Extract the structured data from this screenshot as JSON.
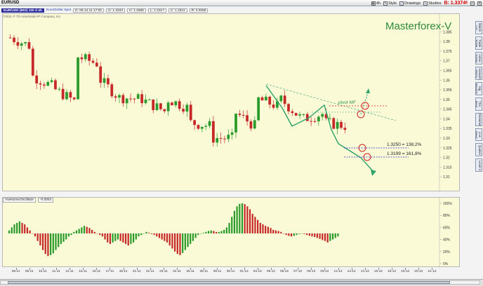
{
  "window": {
    "symbol": "EURUSD",
    "bid_price": "B: 1.3374",
    "bid_suffix": "6",
    "toolbar": [
      {
        "label": "4h",
        "icon": "timeframe-icon"
      },
      {
        "label": "Style",
        "icon": "style-icon"
      },
      {
        "label": "Drawings",
        "icon": "drawings-icon"
      },
      {
        "label": "Studies",
        "icon": "studies-icon"
      }
    ]
  },
  "infobar": {
    "sym": "EUR/USD (BID) 100 d 4h",
    "symname": "Euro/Dollar Spot",
    "date": "D: 09.12.11 17:00",
    "open": "O: 1.3333",
    "high": "H: 1.3386",
    "low": "L: 1.3317",
    "close": "C: 1.3341",
    "range": "R: 0.0069"
  },
  "copyright": "©2011 ® TD Ameritrade IP Company, Inc.",
  "annotations": {
    "brand": "Masterforex-V",
    "pivot": "pivot MF",
    "level1": "1.3250 = 138,2%",
    "level2": "1.3199 = 161,8%"
  },
  "oscillator": {
    "name": "AwesomeOscillator",
    "value": "-0.0054"
  },
  "sidepanel": [
    "Watch List",
    "Trade Ticket",
    "Active Trader",
    "Account Status",
    "Dig Reports",
    "TDA Real Time",
    "Screener",
    "Live News",
    "Quotes",
    "Level II"
  ],
  "colors": {
    "up": "#2a9a2a",
    "down": "#c62828",
    "price_bg": "#fafad7",
    "wave": "#2fa36a",
    "circle": "#d32020",
    "level_line": "#2a2acc"
  },
  "chart_data": [
    {
      "type": "candlestick",
      "title": "EURUSD 4h",
      "ylim": [
        1.305,
        1.392
      ],
      "yticks": [
        "1.385",
        "1.38",
        "1.375",
        "1.37",
        "1.365",
        "1.36",
        "1.355",
        "1.35",
        "1.345",
        "1.34",
        "1.335",
        "1.33",
        "1.325",
        "1.32",
        "1.315",
        "1.31"
      ],
      "xticks": [
        "08.11",
        "09.11",
        "10.11",
        "11.11",
        "14.11",
        "15.11",
        "16.11",
        "17.11",
        "18.11",
        "21.11",
        "22.11",
        "23.11",
        "24.11",
        "25.11",
        "28.11",
        "29.11",
        "30.11",
        "01.12",
        "02.12",
        "05.12",
        "06.12",
        "07.12",
        "08.12",
        "09.12",
        "12.12",
        "13.12",
        "14.12",
        "15.12",
        "16.12",
        "19.12",
        "20.12",
        "21.12"
      ],
      "segments": [
        [
          1.382,
          1.385,
          1.37,
          1.377
        ],
        [
          1.362,
          1.371,
          1.345,
          1.356
        ],
        [
          1.355,
          1.36,
          1.347,
          1.348
        ],
        [
          1.372,
          1.381,
          1.364,
          1.368
        ],
        [
          1.36,
          1.363,
          1.348,
          1.349
        ],
        [
          1.351,
          1.357,
          1.342,
          1.35
        ],
        [
          1.349,
          1.352,
          1.34,
          1.343
        ],
        [
          1.35,
          1.357,
          1.345,
          1.345
        ],
        [
          1.338,
          1.346,
          1.333,
          1.336
        ],
        [
          1.33,
          1.337,
          1.32,
          1.33
        ],
        [
          1.343,
          1.346,
          1.328,
          1.335
        ],
        [
          1.35,
          1.354,
          1.34,
          1.346
        ],
        [
          1.35,
          1.353,
          1.335,
          1.339
        ],
        [
          1.34,
          1.35,
          1.332,
          1.343
        ],
        [
          1.338,
          1.344,
          1.332,
          1.336
        ]
      ],
      "candles_per_segment": 6
    },
    {
      "type": "bar",
      "title": "AwesomeOscillator",
      "yticks": [
        "100%",
        "80%",
        "60%",
        "40%",
        "20%",
        "0%"
      ],
      "values": [
        0.1,
        0.2,
        0.3,
        0.35,
        0.4,
        0.35,
        0.3,
        0.2,
        0.1,
        0.0,
        -0.1,
        -0.25,
        -0.4,
        -0.55,
        -0.68,
        -0.75,
        -0.72,
        -0.66,
        -0.55,
        -0.45,
        -0.35,
        -0.28,
        -0.2,
        -0.1,
        -0.05,
        0.05,
        0.1,
        0.15,
        0.2,
        0.25,
        0.22,
        0.18,
        0.12,
        0.05,
        0.0,
        -0.05,
        -0.1,
        -0.2,
        -0.3,
        -0.35,
        -0.3,
        -0.25,
        -0.2,
        -0.25,
        -0.3,
        -0.35,
        -0.4,
        -0.35,
        -0.3,
        -0.2,
        -0.1,
        -0.05,
        0.0,
        0.05,
        0.02,
        -0.02,
        -0.05,
        -0.1,
        -0.15,
        -0.2,
        -0.25,
        -0.3,
        -0.4,
        -0.5,
        -0.6,
        -0.68,
        -0.72,
        -0.65,
        -0.55,
        -0.45,
        -0.35,
        -0.25,
        -0.15,
        -0.05,
        0.0,
        0.02,
        0.05,
        0.08,
        0.1,
        0.08,
        0.05,
        0.05,
        0.08,
        0.12,
        0.2,
        0.35,
        0.55,
        0.75,
        0.9,
        0.98,
        1.0,
        0.97,
        0.9,
        0.8,
        0.65,
        0.55,
        0.45,
        0.35,
        0.3,
        0.25,
        0.22,
        0.18,
        0.12,
        0.1,
        0.08,
        0.05,
        0.0,
        -0.05,
        -0.08,
        -0.1,
        -0.08,
        -0.05,
        -0.02,
        0.0,
        -0.02,
        -0.05,
        -0.08,
        -0.1,
        -0.12,
        -0.15,
        -0.18,
        -0.22,
        -0.25,
        -0.3,
        -0.25,
        -0.2,
        -0.15,
        -0.1
      ]
    }
  ]
}
